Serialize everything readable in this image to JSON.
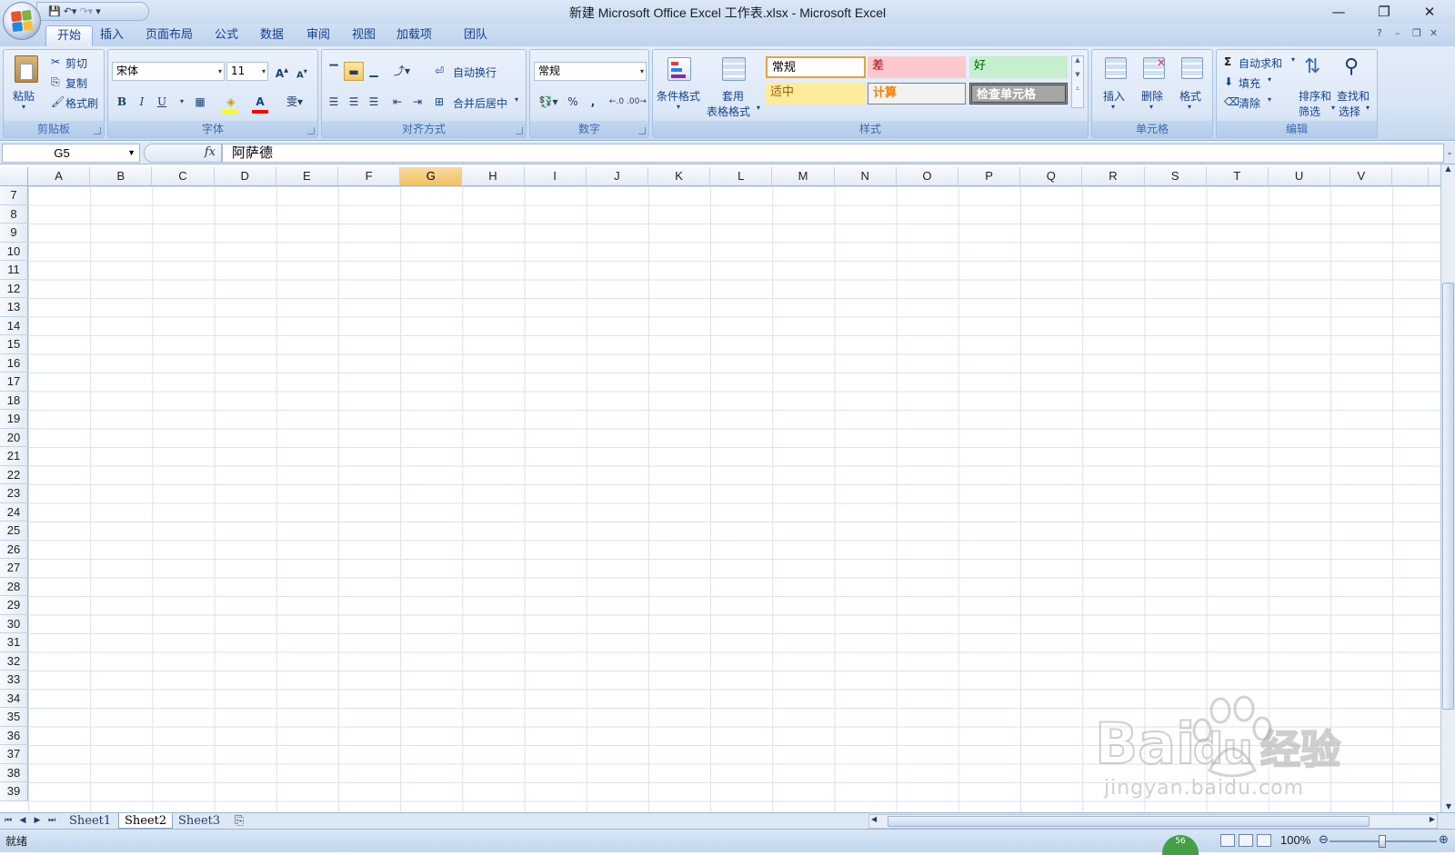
{
  "window": {
    "title": "新建 Microsoft Office Excel 工作表.xlsx - Microsoft Excel",
    "minimize": "—",
    "restore": "❐",
    "close": "✕"
  },
  "quick_access": {
    "save_icon": "save-icon",
    "undo_icon": "undo-icon",
    "redo_icon": "redo-icon"
  },
  "tabs": [
    {
      "label": "开始",
      "active": true
    },
    {
      "label": "插入"
    },
    {
      "label": "页面布局"
    },
    {
      "label": "公式"
    },
    {
      "label": "数据"
    },
    {
      "label": "审阅"
    },
    {
      "label": "视图"
    },
    {
      "label": "加载项"
    },
    {
      "label": "团队"
    }
  ],
  "ribbon": {
    "clipboard": {
      "label": "剪贴板",
      "paste": "粘贴",
      "cut": "剪切",
      "copy": "复制",
      "format_painter": "格式刷"
    },
    "font": {
      "label": "字体",
      "font_name": "宋体",
      "font_size": "11",
      "bold": "B",
      "italic": "I",
      "underline": "U"
    },
    "alignment": {
      "label": "对齐方式",
      "wrap_text": "自动换行",
      "merge_center": "合并后居中"
    },
    "number": {
      "label": "数字",
      "format": "常规",
      "percent": "%",
      "comma": ","
    },
    "styles": {
      "label": "样式",
      "conditional_format": "条件格式",
      "table_format_1": "套用",
      "table_format_2": "表格格式",
      "cells": [
        {
          "text": "常规",
          "bg": "#ffffff",
          "fg": "#000000"
        },
        {
          "text": "差",
          "bg": "#ffc7ce",
          "fg": "#9c0006"
        },
        {
          "text": "好",
          "bg": "#c6efce",
          "fg": "#006100"
        },
        {
          "text": "适中",
          "bg": "#ffeb9c",
          "fg": "#9c6500"
        },
        {
          "text": "计算",
          "bg": "#f2f2f2",
          "fg": "#fa7d00"
        },
        {
          "text": "检查单元格",
          "bg": "#a5a5a5",
          "fg": "#ffffff"
        }
      ]
    },
    "cells_group": {
      "label": "单元格",
      "insert": "插入",
      "delete": "删除",
      "format": "格式"
    },
    "editing": {
      "label": "编辑",
      "autosum": "自动求和",
      "fill": "填充",
      "clear": "清除",
      "sort_1": "排序和",
      "sort_2": "筛选",
      "find_1": "查找和",
      "find_2": "选择"
    }
  },
  "formula_bar": {
    "name_box": "G5",
    "fx": "fx",
    "content": "阿萨德"
  },
  "grid": {
    "columns": [
      "A",
      "B",
      "C",
      "D",
      "E",
      "F",
      "G",
      "H",
      "I",
      "J",
      "K",
      "L",
      "M",
      "N",
      "O",
      "P",
      "Q",
      "R",
      "S",
      "T",
      "U",
      "V"
    ],
    "selected_column": "G",
    "rows": [
      "7",
      "8",
      "9",
      "10",
      "11",
      "12",
      "13",
      "14",
      "15",
      "16",
      "17",
      "18",
      "19",
      "20",
      "21",
      "22",
      "23",
      "24",
      "25",
      "26",
      "27",
      "28",
      "29",
      "30",
      "31",
      "32",
      "33",
      "34",
      "35",
      "36",
      "37",
      "38",
      "39"
    ]
  },
  "sheets": [
    {
      "name": "Sheet1"
    },
    {
      "name": "Sheet2",
      "active": true
    },
    {
      "name": "Sheet3"
    }
  ],
  "status": {
    "ready": "就绪",
    "zoom": "100%",
    "badge": "56"
  },
  "watermark": {
    "brand": "Bai du 经验",
    "url": "jingyan.baidu.com"
  }
}
